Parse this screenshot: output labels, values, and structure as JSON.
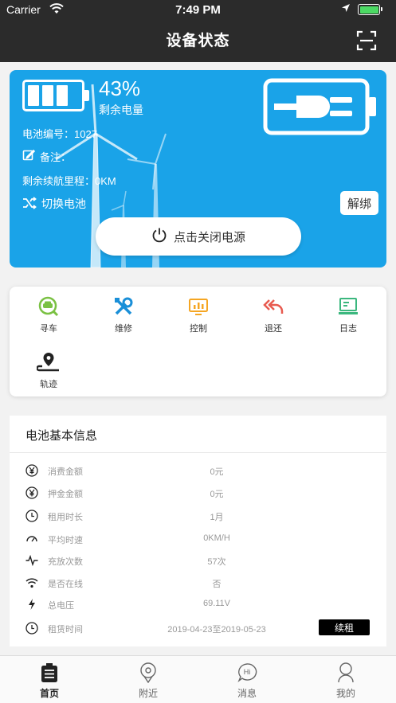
{
  "status_bar": {
    "carrier": "Carrier",
    "time": "7:49 PM"
  },
  "nav": {
    "title": "设备状态"
  },
  "battery_card": {
    "percent": "43%",
    "percent_label": "剩余电量",
    "battery_level": 0.43,
    "battery_id": "电池编号：1027",
    "note": "备注：",
    "range": "剩余续航里程：0KM",
    "swap_label": "切换电池",
    "unbind_label": "解绑",
    "power_label": "点击关闭电源",
    "bg_color": "#1aa3e8"
  },
  "menu": {
    "items": [
      {
        "label": "寻车",
        "icon": "find-car-icon",
        "color": "#7ac143"
      },
      {
        "label": "维修",
        "icon": "repair-icon",
        "color": "#1a8fd8"
      },
      {
        "label": "控制",
        "icon": "control-icon",
        "color": "#f5a623"
      },
      {
        "label": "退还",
        "icon": "return-icon",
        "color": "#e85a4f"
      },
      {
        "label": "日志",
        "icon": "log-icon",
        "color": "#3bb77e"
      },
      {
        "label": "轨迹",
        "icon": "track-icon",
        "color": "#222222"
      }
    ]
  },
  "info": {
    "title": "电池基本信息",
    "rows": [
      {
        "label": "消费金额",
        "value": "0元",
        "icon": "yen-icon"
      },
      {
        "label": "押金金额",
        "value": "0元",
        "icon": "yen-icon"
      },
      {
        "label": "租用时长",
        "value": "1月",
        "icon": "clock-icon"
      },
      {
        "label": "平均时速",
        "value": "0KM/H",
        "icon": "speed-icon"
      },
      {
        "label": "充放次数",
        "value": "57次",
        "icon": "pulse-icon"
      },
      {
        "label": "是否在线",
        "value": "否",
        "icon": "wifi-icon"
      },
      {
        "label": "总电压",
        "value": "69.11V",
        "icon": "bolt-icon"
      },
      {
        "label": "租赁时间",
        "value": "2019-04-23至2019-05-23",
        "icon": "clock-icon"
      }
    ],
    "renew_label": "续租"
  },
  "tabbar": {
    "tabs": [
      {
        "label": "首页",
        "icon": "home-battery-icon",
        "active": true
      },
      {
        "label": "附近",
        "icon": "location-icon",
        "active": false
      },
      {
        "label": "消息",
        "icon": "message-icon",
        "active": false
      },
      {
        "label": "我的",
        "icon": "profile-icon",
        "active": false
      }
    ]
  }
}
